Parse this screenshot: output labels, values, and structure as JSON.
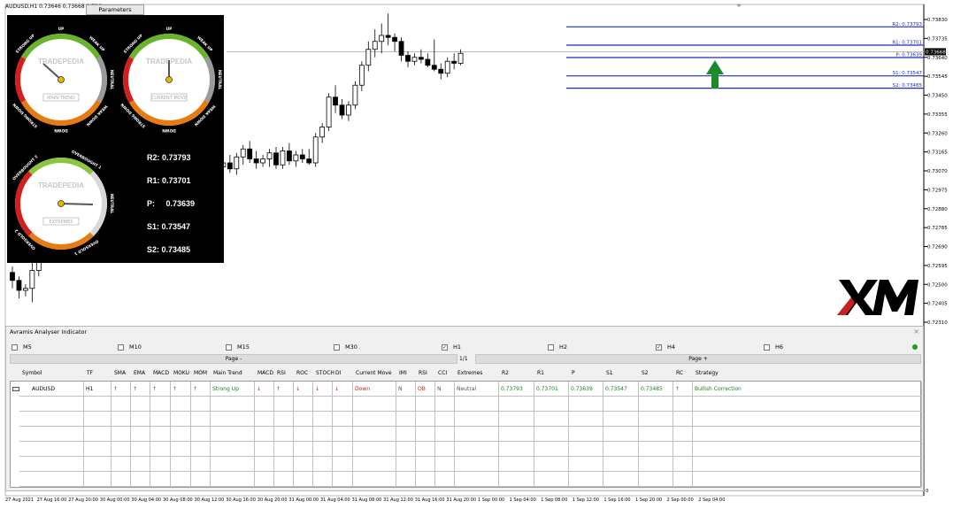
{
  "window": {
    "title": "AUDUSD,H1  0.73646 0.73668 0.736",
    "params_button": "Parameters"
  },
  "price_axis": {
    "ticks": [
      "0.73830",
      "0.73735",
      "0.73640",
      "0.73545",
      "0.73450",
      "0.73355",
      "0.73260",
      "0.73165",
      "0.73070",
      "0.72975",
      "0.72880",
      "0.72785",
      "0.72690",
      "0.72595",
      "0.72500",
      "0.72405",
      "0.72310"
    ],
    "current_price_label": "0.73668",
    "zero_label": "0"
  },
  "pivot_lines": [
    {
      "label": "R2: 0.73793",
      "value": 0.73793,
      "color": "#1c2fbd"
    },
    {
      "label": "R1: 0.73701",
      "value": 0.73701,
      "color": "#1c2fbd"
    },
    {
      "label": "P: 0.73639",
      "value": 0.73639,
      "color": "#1c2fbd"
    },
    {
      "label": "S1: 0.73547",
      "value": 0.73547,
      "color": "#1c2fbd"
    },
    {
      "label": "S2: 0.73485",
      "value": 0.73485,
      "color": "#1c2fbd"
    }
  ],
  "time_axis": [
    "27 Aug 2021",
    "27 Aug 16:00",
    "27 Aug 20:00",
    "30 Aug 00:00",
    "30 Aug 04:00",
    "30 Aug 08:00",
    "30 Aug 12:00",
    "30 Aug 16:00",
    "30 Aug 20:00",
    "31 Aug 00:00",
    "31 Aug 04:00",
    "31 Aug 08:00",
    "31 Aug 12:00",
    "31 Aug 16:00",
    "31 Aug 20:00",
    "1 Sep 00:00",
    "1 Sep 04:00",
    "1 Sep 08:00",
    "1 Sep 12:00",
    "1 Sep 16:00",
    "1 Sep 20:00",
    "2 Sep 00:00",
    "2 Sep 04:00"
  ],
  "candles": [
    [
      0.7256,
      0.7259,
      0.7248,
      0.7252
    ],
    [
      0.7252,
      0.7254,
      0.7243,
      0.7247
    ],
    [
      0.7247,
      0.725,
      0.7244,
      0.7248
    ],
    [
      0.7248,
      0.7262,
      0.7241,
      0.7257
    ],
    [
      0.7257,
      0.727,
      0.7254,
      0.7268
    ],
    [
      0.7268,
      0.729,
      0.7265,
      0.7287
    ],
    [
      0.7287,
      0.7295,
      0.7284,
      0.7292
    ],
    [
      0.7292,
      0.7296,
      0.7287,
      0.7289
    ],
    [
      0.7289,
      0.7294,
      0.728,
      0.7285
    ],
    [
      0.7285,
      0.7291,
      0.7283,
      0.729
    ],
    [
      0.729,
      0.7296,
      0.7288,
      0.7294
    ],
    [
      0.7294,
      0.7298,
      0.729,
      0.7292
    ],
    [
      0.7292,
      0.7295,
      0.7288,
      0.729
    ],
    [
      0.729,
      0.7299,
      0.7287,
      0.7296
    ],
    [
      0.7296,
      0.73,
      0.729,
      0.7293
    ],
    [
      0.7293,
      0.7296,
      0.7279,
      0.729
    ],
    [
      0.729,
      0.7296,
      0.7288,
      0.7292
    ],
    [
      0.7292,
      0.7302,
      0.7287,
      0.7297
    ],
    [
      0.7297,
      0.7299,
      0.7286,
      0.7288
    ],
    [
      0.7288,
      0.7299,
      0.7286,
      0.7296
    ],
    [
      0.7296,
      0.731,
      0.7293,
      0.7308
    ],
    [
      0.7308,
      0.733,
      0.7306,
      0.7329
    ],
    [
      0.7329,
      0.7342,
      0.7326,
      0.7337
    ],
    [
      0.7337,
      0.734,
      0.7329,
      0.7332
    ],
    [
      0.7332,
      0.7336,
      0.7325,
      0.7329
    ],
    [
      0.7329,
      0.7335,
      0.7327,
      0.7328
    ],
    [
      0.7328,
      0.7332,
      0.7323,
      0.7325
    ],
    [
      0.7325,
      0.7331,
      0.7322,
      0.7328
    ],
    [
      0.7328,
      0.7331,
      0.7321,
      0.7325
    ],
    [
      0.7325,
      0.7329,
      0.7312,
      0.731
    ],
    [
      0.731,
      0.7313,
      0.7305,
      0.7306
    ],
    [
      0.7306,
      0.7311,
      0.7303,
      0.7309
    ],
    [
      0.7309,
      0.7313,
      0.7306,
      0.7311
    ],
    [
      0.7311,
      0.7315,
      0.7306,
      0.7308
    ],
    [
      0.7308,
      0.7316,
      0.7305,
      0.7314
    ],
    [
      0.7314,
      0.732,
      0.731,
      0.7318
    ],
    [
      0.7318,
      0.7322,
      0.7311,
      0.7313
    ],
    [
      0.7313,
      0.7317,
      0.7308,
      0.7311
    ],
    [
      0.7311,
      0.7315,
      0.7309,
      0.7313
    ],
    [
      0.7313,
      0.7318,
      0.7309,
      0.7316
    ],
    [
      0.7316,
      0.7319,
      0.7308,
      0.731
    ],
    [
      0.731,
      0.7319,
      0.7308,
      0.7317
    ],
    [
      0.7317,
      0.7321,
      0.731,
      0.7312
    ],
    [
      0.7312,
      0.7317,
      0.7309,
      0.7315
    ],
    [
      0.7315,
      0.7318,
      0.7311,
      0.7313
    ],
    [
      0.7313,
      0.7318,
      0.731,
      0.7311
    ],
    [
      0.7311,
      0.7326,
      0.7309,
      0.7324
    ],
    [
      0.7324,
      0.7331,
      0.7321,
      0.7329
    ],
    [
      0.7329,
      0.7346,
      0.7327,
      0.7344
    ],
    [
      0.7344,
      0.735,
      0.7336,
      0.734
    ],
    [
      0.734,
      0.7343,
      0.7333,
      0.7335
    ],
    [
      0.7335,
      0.7342,
      0.7332,
      0.734
    ],
    [
      0.734,
      0.7352,
      0.7338,
      0.735
    ],
    [
      0.735,
      0.7362,
      0.7347,
      0.736
    ],
    [
      0.736,
      0.7372,
      0.7357,
      0.7368
    ],
    [
      0.7368,
      0.7378,
      0.7364,
      0.7372
    ],
    [
      0.7372,
      0.7381,
      0.7366,
      0.7375
    ],
    [
      0.7375,
      0.7386,
      0.737,
      0.7374
    ],
    [
      0.7374,
      0.7376,
      0.7367,
      0.7372
    ],
    [
      0.7372,
      0.7374,
      0.7362,
      0.7365
    ],
    [
      0.7365,
      0.7367,
      0.7359,
      0.7362
    ],
    [
      0.7362,
      0.7366,
      0.736,
      0.7364
    ],
    [
      0.7364,
      0.7368,
      0.7361,
      0.7363
    ],
    [
      0.7363,
      0.7366,
      0.7359,
      0.736
    ],
    [
      0.736,
      0.7373,
      0.7357,
      0.7358
    ],
    [
      0.7358,
      0.7361,
      0.7353,
      0.7356
    ],
    [
      0.7356,
      0.7364,
      0.7354,
      0.7362
    ],
    [
      0.7362,
      0.7366,
      0.7358,
      0.7361
    ],
    [
      0.7361,
      0.7368,
      0.736,
      0.7366
    ]
  ],
  "gauges": [
    {
      "brand": "TRADEPEDIA",
      "caption": "MAIN TREND",
      "labels": [
        "STRONG UP",
        "UP",
        "WEAK UP",
        "NEUTRAL",
        "WEAK DOWN",
        "DOWN",
        "STRONG DOWN"
      ],
      "needle": 0.25
    },
    {
      "brand": "TRADEPEDIA",
      "caption": "CURRENT MOVE",
      "labels": [
        "STRONG UP",
        "UP",
        "WEAK UP",
        "NEUTRAL",
        "WEAK DOWN",
        "DOWN",
        "STRONG DOWN"
      ],
      "needle": 0.5
    },
    {
      "brand": "TRADEPEDIA",
      "caption": "EXTREMES",
      "labels": [
        "OVERBOUGHT 2",
        "OVERBOUGHT 1",
        "NEUTRAL",
        "OVERSOLD 1",
        "OVERSOLD 2"
      ],
      "needle": 0.5
    }
  ],
  "pivots_panel": [
    {
      "name": "R2:",
      "value": "0.73793"
    },
    {
      "name": "R1:",
      "value": "0.73701"
    },
    {
      "name": "P:",
      "value": "0.73639"
    },
    {
      "name": "S1:",
      "value": "0.73547"
    },
    {
      "name": "S2:",
      "value": "0.73485"
    }
  ],
  "indicator": {
    "title": "Avramis Analyser Indicator",
    "close": "×",
    "timeframes": [
      {
        "label": "M5",
        "checked": false
      },
      {
        "label": "M10",
        "checked": false
      },
      {
        "label": "M15",
        "checked": false
      },
      {
        "label": "M30",
        "checked": false
      },
      {
        "label": "H1",
        "checked": true
      },
      {
        "label": "H2",
        "checked": false
      },
      {
        "label": "H4",
        "checked": true
      },
      {
        "label": "H6",
        "checked": false
      }
    ],
    "page_minus": "Page -",
    "page_plus": "Page +",
    "page_count": "1/1",
    "headers": [
      "Symbol",
      "TF",
      "SMA",
      "EMA",
      "MACD",
      "MOKU",
      "MOM",
      "Main Trend",
      "MACD",
      "RSI",
      "ROC",
      "STOCH",
      "DI",
      "Current Move",
      "IMI",
      "RSI",
      "CCI",
      "Extremes",
      "R2",
      "R1",
      "P",
      "S1",
      "S2",
      "RC",
      "Strategy"
    ],
    "row": [
      "AUDUSD",
      "H1",
      "↑",
      "↑",
      "↑",
      "↑",
      "↑",
      "Strong Up",
      "↓",
      "↑",
      "↓",
      "↓",
      "↓",
      "Down",
      "N",
      "OB",
      "N",
      "Neutral",
      "0.73793",
      "0.73701",
      "0.73639",
      "0.73547",
      "0.73485",
      "↑",
      "Bullish Correction"
    ]
  },
  "logo_text": "XM"
}
